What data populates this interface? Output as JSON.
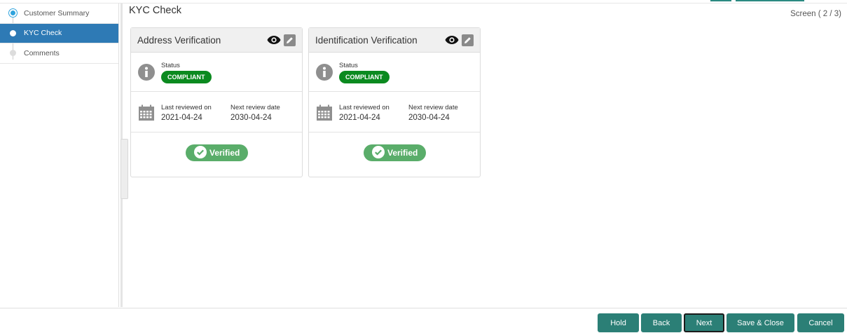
{
  "header": {
    "title": "KYC Check",
    "screen": "Screen ( 2 / 3)"
  },
  "sidebar": {
    "items": [
      {
        "label": "Customer Summary"
      },
      {
        "label": "KYC Check"
      },
      {
        "label": "Comments"
      }
    ]
  },
  "cards": [
    {
      "title": "Address Verification",
      "status_label": "Status",
      "status": "COMPLIANT",
      "last_reviewed_label": "Last reviewed on",
      "last_reviewed": "2021-04-24",
      "next_review_label": "Next review date",
      "next_review": "2030-04-24",
      "verified": "Verified"
    },
    {
      "title": "Identification Verification",
      "status_label": "Status",
      "status": "COMPLIANT",
      "last_reviewed_label": "Last reviewed on",
      "last_reviewed": "2021-04-24",
      "next_review_label": "Next review date",
      "next_review": "2030-04-24",
      "verified": "Verified"
    }
  ],
  "footer": {
    "hold": "Hold",
    "back": "Back",
    "next": "Next",
    "save_close": "Save & Close",
    "cancel": "Cancel"
  },
  "colors": {
    "accent": "#2e7ab5",
    "button": "#2b7f76",
    "compliant": "#0b8a1f",
    "verified": "#5aad6a"
  }
}
